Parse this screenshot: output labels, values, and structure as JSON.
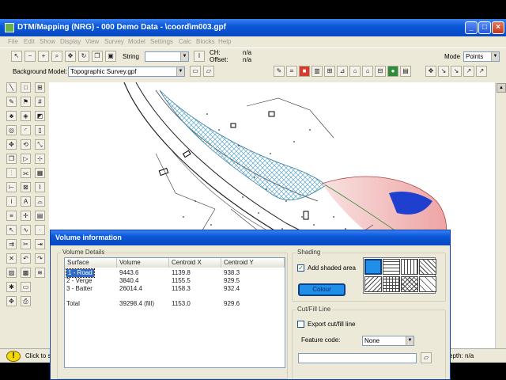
{
  "window": {
    "title": "DTM/Mapping (NRG) - 000 Demo Data - \\coord\\m003.gpf",
    "icons": [
      "app-icon",
      "minimize-icon",
      "maximize-icon",
      "close-icon"
    ]
  },
  "menu": [
    "File",
    "Edit",
    "Show",
    "Display",
    "View",
    "Survey",
    "Model",
    "Settings",
    "Calc",
    "Blocks",
    "Help"
  ],
  "toolbar": {
    "string_label": "String",
    "string_value": "",
    "ch_label": "CH:",
    "offset_label": "Offset:",
    "ch_value": "n/a",
    "offset_value": "n/a",
    "mode_label": "Mode",
    "mode_value": "Points"
  },
  "background_model": {
    "label": "Background Model:",
    "value": "Topographic Survey.gpf"
  },
  "statusbar": {
    "hint": "Click to s",
    "right": "epth: n/a"
  },
  "dialog": {
    "title": "Volume information",
    "volume_details_label": "Volume Details",
    "columns": [
      "Surface",
      "Volume",
      "Centroid X",
      "Centroid Y"
    ],
    "rows": [
      {
        "surface": "1 - Road",
        "volume": "9443.6",
        "cx": "1139.8",
        "cy": "938.3"
      },
      {
        "surface": "2 - Verge",
        "volume": "3840.4",
        "cx": "1155.5",
        "cy": "929.5"
      },
      {
        "surface": "3 - Batter",
        "volume": "26014.4",
        "cx": "1158.3",
        "cy": "932.4"
      }
    ],
    "total": {
      "surface": "Total",
      "volume": "39298.4 (fill)",
      "cx": "1153.0",
      "cy": "929.6"
    },
    "shading_label": "Shading",
    "add_shaded_area": "Add shaded area",
    "add_shaded_checked": true,
    "colour_button": "Colour",
    "colour_value": "#1f8fe8",
    "cutfill_label": "Cut/Fill Line",
    "export_cutfill": "Export cut/fill line",
    "export_checked": false,
    "feature_code_label": "Feature code:",
    "feature_code_value": "None"
  },
  "colors": {
    "accent": "#0a58d8",
    "hatch": "#5fa8c9",
    "selection": "#316ac5"
  }
}
